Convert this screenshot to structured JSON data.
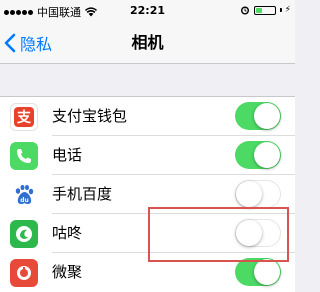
{
  "status_bar": {
    "carrier": "中国联通",
    "time": "22:21",
    "battery_percent": 35,
    "signal_bars": 5
  },
  "nav": {
    "back_label": "隐私",
    "title": "相机"
  },
  "apps": [
    {
      "label": "支付宝钱包",
      "enabled": true,
      "icon": "alipay-icon",
      "icon_color": "#e8412c"
    },
    {
      "label": "电话",
      "enabled": true,
      "icon": "phone-icon",
      "icon_color": "#4cd964"
    },
    {
      "label": "手机百度",
      "enabled": false,
      "icon": "baidu-icon",
      "icon_color": "#2f6fd1"
    },
    {
      "label": "咕咚",
      "enabled": false,
      "icon": "codoon-icon",
      "icon_color": "#2db84c"
    },
    {
      "label": "微聚",
      "enabled": true,
      "icon": "weiju-icon",
      "icon_color": "#e84a3a"
    }
  ],
  "colors": {
    "accent": "#007aff",
    "toggle_on": "#4cd964",
    "highlight": "#d9534f"
  }
}
